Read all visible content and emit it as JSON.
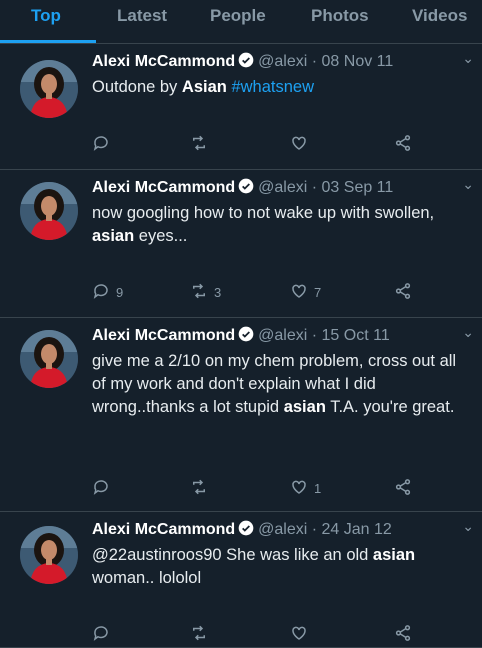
{
  "tabs": [
    "Top",
    "Latest",
    "People",
    "Photos",
    "Videos"
  ],
  "colors": {
    "background": "#15202b",
    "accent": "#1da1f2",
    "muted": "#8899a6",
    "divider": "#38444d"
  },
  "icons": {
    "reply": "reply-icon",
    "retweet": "retweet-icon",
    "like": "heart-icon",
    "share": "share-icon",
    "verified": "verified-badge-icon",
    "menu": "chevron-down-icon"
  },
  "tweets": [
    {
      "name": "Alexi McCammond",
      "handle": "@alexi",
      "date": "· 08 Nov 11",
      "text": [
        {
          "t": "Outdone by "
        },
        {
          "t": "Asian",
          "b": true
        },
        {
          "t": " "
        },
        {
          "t": "#whatsnew",
          "tag": true
        }
      ],
      "replies": "",
      "retweets": "",
      "likes": ""
    },
    {
      "name": "Alexi McCammond",
      "handle": "@alexi",
      "date": "· 03 Sep 11",
      "text": [
        {
          "t": "now googling how to not wake up with swollen, "
        },
        {
          "t": "asian",
          "b": true
        },
        {
          "t": " eyes..."
        }
      ],
      "replies": "9",
      "retweets": "3",
      "likes": "7"
    },
    {
      "name": "Alexi McCammond",
      "handle": "@alexi",
      "date": "· 15 Oct 11",
      "text": [
        {
          "t": "give me a 2/10 on my chem problem, cross out all of my work and don't explain what I did wrong..thanks a lot stupid "
        },
        {
          "t": "asian",
          "b": true
        },
        {
          "t": " T.A. you're great."
        }
      ],
      "replies": "",
      "retweets": "",
      "likes": "1"
    },
    {
      "name": "Alexi McCammond",
      "handle": "@alexi",
      "date": "· 24 Jan 12",
      "text": [
        {
          "t": "@22austinroos90 She was like an old "
        },
        {
          "t": "asian",
          "b": true
        },
        {
          "t": " woman.. lololol"
        }
      ],
      "replies": "",
      "retweets": "",
      "likes": ""
    }
  ]
}
